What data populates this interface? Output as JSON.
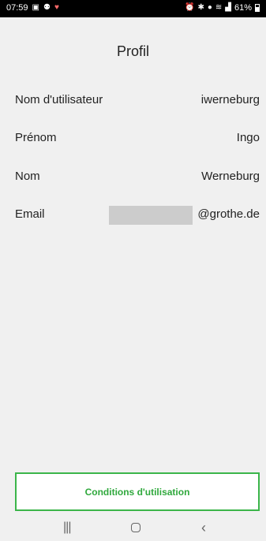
{
  "status_bar": {
    "time": "07:59",
    "battery": "61%",
    "left_icons": [
      "image-icon",
      "android-icon",
      "heart-icon"
    ],
    "right_icons": [
      "alarm-icon",
      "bluetooth-icon",
      "location-icon",
      "wifi-icon",
      "signal-icon",
      "battery-icon"
    ]
  },
  "header": {
    "title": "Profil"
  },
  "profile": {
    "username_label": "Nom d'utilisateur",
    "username_value": "iwerneburg",
    "firstname_label": "Prénom",
    "firstname_value": "Ingo",
    "lastname_label": "Nom",
    "lastname_value": "Werneburg",
    "email_label": "Email",
    "email_value": "@grothe.de"
  },
  "footer": {
    "terms_label": "Conditions d'utilisation"
  },
  "nav": {
    "icons": [
      "recents-icon",
      "home-icon",
      "back-icon"
    ]
  },
  "colors": {
    "accent": "#3bb54a",
    "background": "#f0f0f0"
  }
}
